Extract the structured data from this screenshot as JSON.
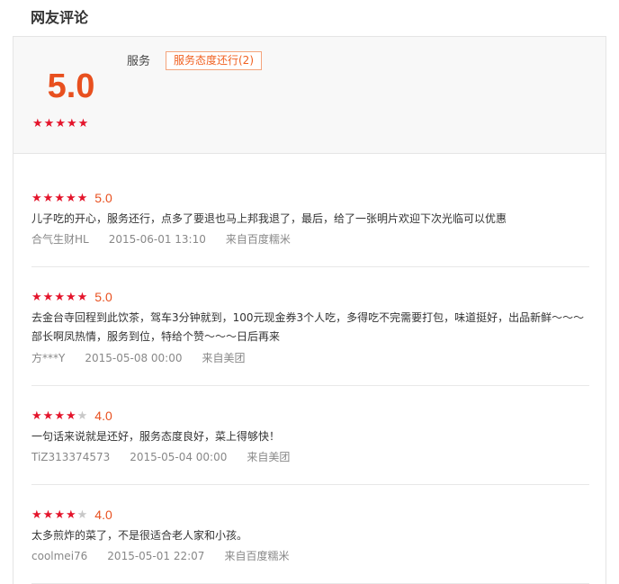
{
  "section_title": "网友评论",
  "summary": {
    "score": "5.0",
    "stars": 5,
    "aspect_label": "服务",
    "tag": "服务态度还行(2)"
  },
  "reviews": [
    {
      "rating": 5,
      "score": "5.0",
      "content": "儿子吃的开心，服务还行，点多了要退也马上邦我退了，最后，给了一张明片欢迎下次光临可以优惠",
      "user": "合气生财HL",
      "time": "2015-06-01 13:10",
      "source": "来自百度糯米"
    },
    {
      "rating": 5,
      "score": "5.0",
      "content": "去金台寺回程到此饮茶，驾车3分钟就到，100元现金券3个人吃，多得吃不完需要打包，味道挺好，出品新鲜～～～部长啊凤热情，服务到位，特给个赞～～～日后再来",
      "user": "方***Y",
      "time": "2015-05-08 00:00",
      "source": "来自美团"
    },
    {
      "rating": 4,
      "score": "4.0",
      "content": "一句话来说就是还好，服务态度良好，菜上得够快！",
      "user": "TiZ313374573",
      "time": "2015-05-04 00:00",
      "source": "来自美团"
    },
    {
      "rating": 4,
      "score": "4.0",
      "content": "太多煎炸的菜了，不是很适合老人家和小孩。",
      "user": "coolmei76",
      "time": "2015-05-01 22:07",
      "source": "来自百度糯米"
    }
  ],
  "colors": {
    "accent": "#e8501f",
    "star": "#e4142b",
    "star_off": "#c8c8c8",
    "tag_border": "#f5a47c"
  }
}
